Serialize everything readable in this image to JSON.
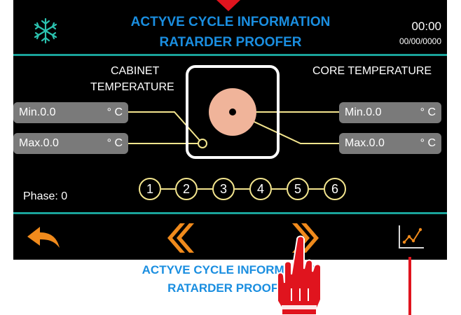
{
  "header": {
    "title_line1": "ACTYVE CYCLE INFORMATION",
    "title_line2": "RATARDER PROOFER",
    "time": "00:00",
    "date": "00/00/0000",
    "mode_icon": "snowflake-icon"
  },
  "cabinet": {
    "label_line1": "CABINET",
    "label_line2": "TEMPERATURE",
    "min_value": "Min.0.0",
    "max_value": "Max.0.0",
    "unit": "° C"
  },
  "core": {
    "label": "CORE TEMPERATURE",
    "min_value": "Min.0.0",
    "max_value": "Max.0.0",
    "unit": "° C"
  },
  "phase": {
    "label": "Phase: 0",
    "steps": [
      "1",
      "2",
      "3",
      "4",
      "5",
      "6"
    ]
  },
  "footer": {
    "back_icon": "back-arrow-icon",
    "prev_icon": "double-chevron-left-icon",
    "next_icon": "double-chevron-right-icon",
    "chart_icon": "chart-icon"
  },
  "caption": {
    "title_line1": "ACTYVE CYCLE INFORMATION",
    "title_line2": "RATARDER PROOFER"
  },
  "colors": {
    "accent_blue": "#1a8ee0",
    "divider_teal": "#1aa39a",
    "orange": "#f08a1c",
    "connector_yellow": "#f3e58e",
    "probe_pink": "#f0b49a",
    "indicator_red": "#e0141e"
  }
}
